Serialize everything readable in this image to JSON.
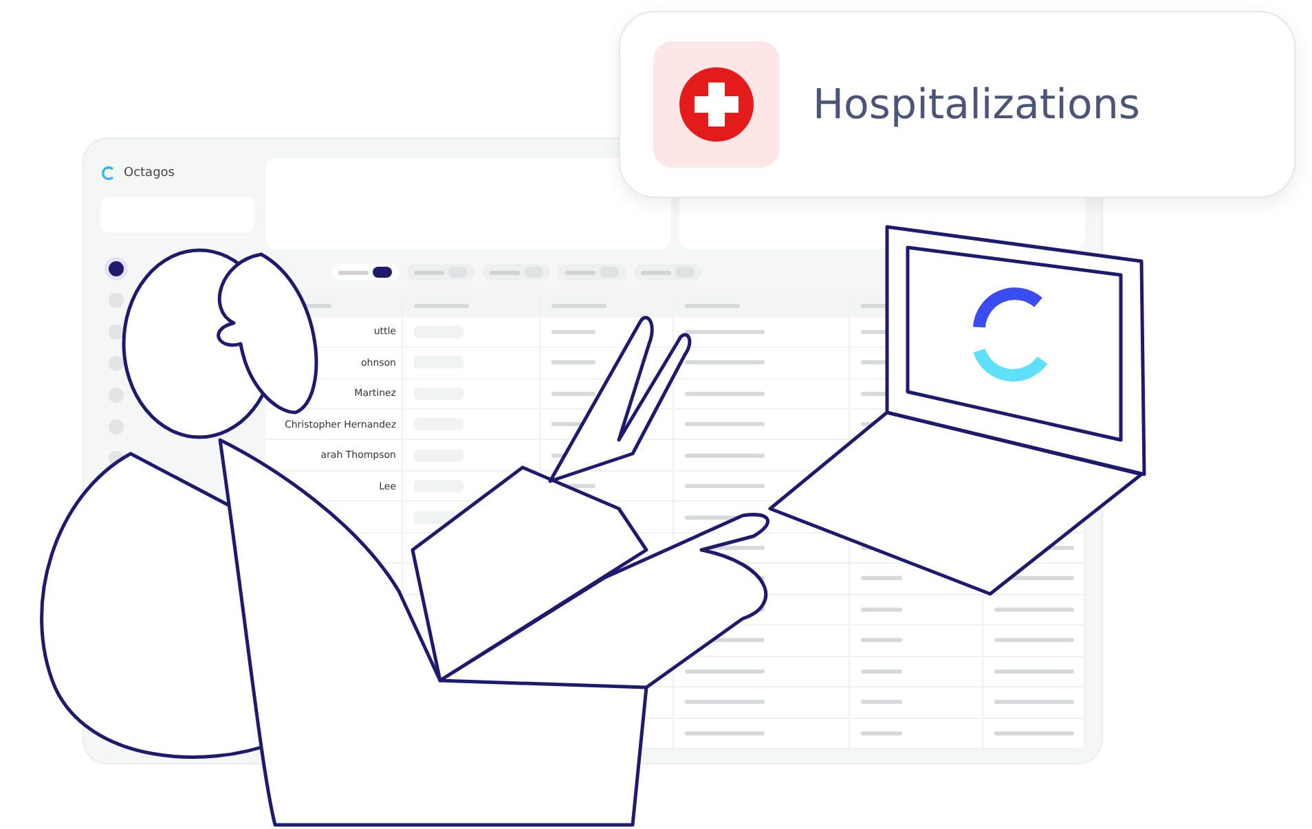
{
  "app": {
    "name": "Octagos"
  },
  "sidebar": {
    "items": [
      {
        "selected": true
      },
      {
        "selected": false
      },
      {
        "selected": false
      },
      {
        "selected": false
      },
      {
        "selected": false
      },
      {
        "selected": false
      },
      {
        "selected": false
      }
    ]
  },
  "filters": [
    {
      "selected": true
    },
    {
      "selected": false
    },
    {
      "selected": false
    },
    {
      "selected": false
    },
    {
      "selected": false
    }
  ],
  "table": {
    "names": [
      "uttle",
      "ohnson",
      "Martinez",
      "Christopher Hernandez",
      "arah Thompson",
      "Lee"
    ]
  },
  "popup": {
    "title": "Hospitalizations"
  }
}
